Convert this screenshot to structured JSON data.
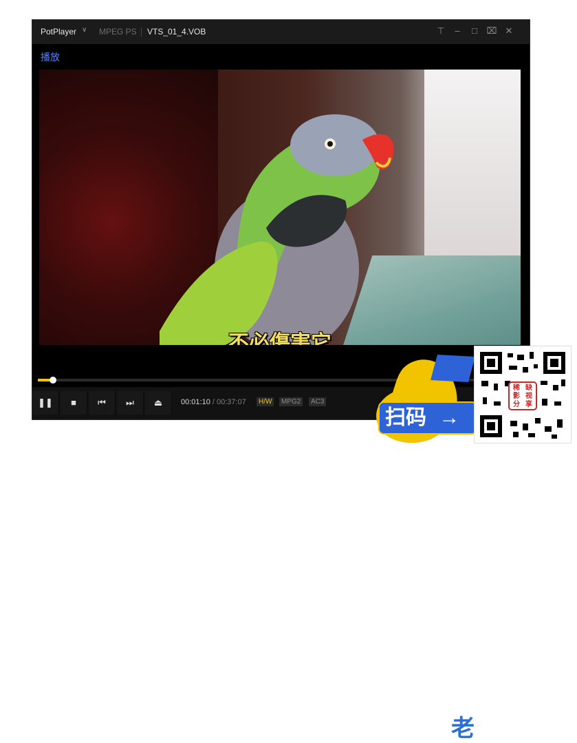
{
  "titlebar": {
    "app_name": "PotPlayer",
    "format": "MPEG PS",
    "file_name": "VTS_01_4.VOB",
    "controls": [
      "pin-icon",
      "minimize-icon",
      "maximize-icon",
      "fullscreen-icon",
      "close-icon"
    ]
  },
  "status": {
    "text": "播放"
  },
  "video": {
    "subtitle": "不必傷害它"
  },
  "playback": {
    "progress": 0.0311,
    "current_time": "00:01:10",
    "separator": "/",
    "duration": "00:37:07",
    "badges": {
      "hw": "H/W",
      "video_codec": "MPG2",
      "audio_codec": "AC3"
    }
  },
  "controls": {
    "buttons": [
      "pause-icon",
      "stop-icon",
      "previous-icon",
      "next-icon",
      "eject-icon"
    ]
  },
  "overlay": {
    "banner_char": "老",
    "scan_text": "扫码",
    "arrow": "→",
    "qr_caption": [
      "稀",
      "缺",
      "影",
      "视",
      "分",
      "享"
    ]
  },
  "colors": {
    "accent": "#f2c400",
    "status_blue": "#4f86ff",
    "subtitle": "#f2dd63"
  }
}
